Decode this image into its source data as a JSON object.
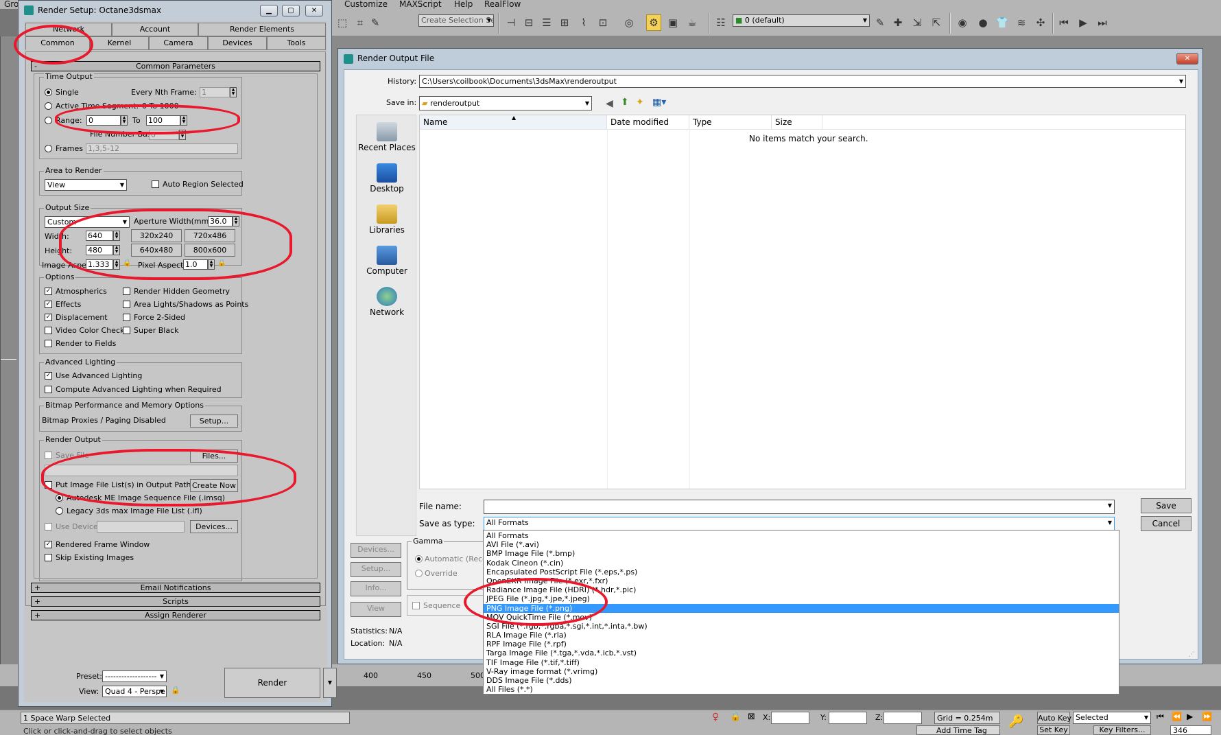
{
  "app": {
    "menu": [
      "Gro",
      "Customize",
      "MAXScript",
      "Help",
      "RealFlow"
    ],
    "selection_set_placeholder": "Create Selection Se",
    "layer_value": "0 (default)"
  },
  "render_setup": {
    "title": "Render Setup: Octane3dsmax",
    "tabs_row1": [
      "Network",
      "Account",
      "Render Elements"
    ],
    "tabs_row2": [
      "Common",
      "Kernel",
      "Camera",
      "Devices",
      "Tools"
    ],
    "rollout_common": "Common Parameters",
    "time_output": {
      "group": "Time Output",
      "single": "Single",
      "every_nth_label": "Every Nth Frame:",
      "every_nth_value": "1",
      "active_segment": "Active Time Segment:",
      "active_segment_value": "0 To 1000",
      "range": "Range:",
      "range_from": "0",
      "range_to_label": "To",
      "range_to": "100",
      "file_number_base_label": "File Number Base:",
      "file_number_base_value": "0",
      "frames": "Frames",
      "frames_value": "1,3,5-12"
    },
    "area": {
      "group": "Area to Render",
      "value": "View",
      "auto_region": "Auto Region Selected"
    },
    "output_size": {
      "group": "Output Size",
      "preset": "Custom",
      "aperture_label": "Aperture Width(mm):",
      "aperture_value": "36.0",
      "width_label": "Width:",
      "width_value": "640",
      "height_label": "Height:",
      "height_value": "480",
      "presets": [
        "320x240",
        "720x486",
        "640x480",
        "800x600"
      ],
      "image_aspect_label": "Image Aspect:",
      "image_aspect_value": "1.333",
      "pixel_aspect_label": "Pixel Aspect:",
      "pixel_aspect_value": "1.0"
    },
    "options": {
      "group": "Options",
      "atmospherics": "Atmospherics",
      "render_hidden": "Render Hidden Geometry",
      "effects": "Effects",
      "area_lights": "Area Lights/Shadows as Points",
      "displacement": "Displacement",
      "force_2sided": "Force 2-Sided",
      "video_color": "Video Color Check",
      "super_black": "Super Black",
      "render_fields": "Render to Fields"
    },
    "advanced_lighting": {
      "group": "Advanced Lighting",
      "use": "Use Advanced Lighting",
      "compute": "Compute Advanced Lighting when Required"
    },
    "bitmap": {
      "group": "Bitmap Performance and Memory Options",
      "status": "Bitmap Proxies / Paging Disabled",
      "setup": "Setup..."
    },
    "render_output": {
      "group": "Render Output",
      "save_file": "Save File",
      "files": "Files...",
      "put_image_list": "Put Image File List(s) in Output Path(s)",
      "create_now": "Create Now",
      "autodesk_seq": "Autodesk ME Image Sequence File (.imsq)",
      "legacy": "Legacy 3ds max Image File List (.ifl)",
      "use_device": "Use Device",
      "devices": "Devices...",
      "rendered_frame_window": "Rendered Frame Window",
      "skip_existing": "Skip Existing Images"
    },
    "rollouts_collapsed": [
      "Email Notifications",
      "Scripts",
      "Assign Renderer"
    ],
    "preset_label": "Preset:",
    "preset_value": "-------------------",
    "view_label": "View:",
    "view_value": "Quad 4 - Perspe",
    "render_button": "Render"
  },
  "file_dialog": {
    "title": "Render Output File",
    "history_label": "History:",
    "history_value": "C:\\Users\\coilbook\\Documents\\3dsMax\\renderoutput",
    "save_in_label": "Save in:",
    "save_in_value": "renderoutput",
    "places": [
      "Recent Places",
      "Desktop",
      "Libraries",
      "Computer",
      "Network"
    ],
    "columns": [
      "Name",
      "Date modified",
      "Type",
      "Size"
    ],
    "empty_message": "No items match your search.",
    "file_name_label": "File name:",
    "file_name_value": "",
    "save_as_type_label": "Save as type:",
    "save_as_type_value": "All Formats",
    "save_button": "Save",
    "cancel_button": "Cancel",
    "side_buttons": [
      "Devices...",
      "Setup...",
      "Info...",
      "View"
    ],
    "gamma_group": "Gamma",
    "gamma_automatic": "Automatic (Recom",
    "gamma_override": "Override",
    "sequence": "Sequence",
    "statistics_label": "Statistics:",
    "statistics_value": "N/A",
    "location_label": "Location:",
    "location_value": "N/A",
    "file_types": [
      "All Formats",
      "AVI File (*.avi)",
      "BMP Image File (*.bmp)",
      "Kodak Cineon (*.cin)",
      "Encapsulated PostScript File (*.eps,*.ps)",
      "OpenEXR Image File (*.exr,*.fxr)",
      "Radiance Image File (HDRI) (*.hdr,*.pic)",
      "JPEG File (*.jpg,*.jpe,*.jpeg)",
      "PNG Image File (*.png)",
      "MOV QuickTime File (*.mov)",
      "SGI File (*.rgb,*.rgba,*.sgi,*.int,*.inta,*.bw)",
      "RLA Image File (*.rla)",
      "RPF Image File (*.rpf)",
      "Targa Image File (*.tga,*.vda,*.icb,*.vst)",
      "TIF Image File (*.tif,*.tiff)",
      "V-Ray image format (*.vrimg)",
      "DDS Image File (*.dds)",
      "All Files (*.*)"
    ],
    "file_types_highlighted_index": 8
  },
  "timeline": {
    "ticks": [
      "400",
      "450",
      "500"
    ]
  },
  "status": {
    "selection": "1 Space Warp Selected",
    "prompt": "Click or click-and-drag to select objects",
    "x_label": "X:",
    "y_label": "Y:",
    "z_label": "Z:",
    "grid": "Grid = 0.254m",
    "auto_key": "Auto Key",
    "selected_value": "Selected",
    "set_key": "Set Key",
    "key_filters": "Key Filters...",
    "add_time_tag": "Add Time Tag",
    "frame": "346"
  },
  "colors": {
    "annotation_red": "#e8192c",
    "highlight_blue": "#3399ff",
    "window_frame": "#c3cdd8",
    "panel_gray": "#c6c6c6"
  }
}
